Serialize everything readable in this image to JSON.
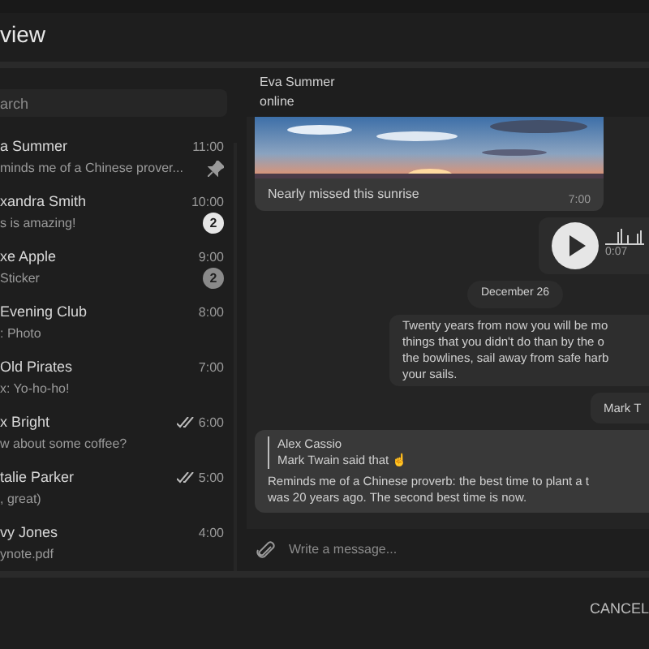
{
  "dialog": {
    "title": "view"
  },
  "search": {
    "placeholder": "arch"
  },
  "chats": [
    {
      "name": "a Summer",
      "time": "11:00",
      "preview": "minds me of a Chinese prover...",
      "kind": "pinned"
    },
    {
      "name": "xandra Smith",
      "time": "10:00",
      "preview": "s is amazing!",
      "kind": "badge",
      "count": "2",
      "muted": false
    },
    {
      "name": "xe Apple",
      "time": "9:00",
      "preview": "Sticker",
      "kind": "badge",
      "count": "2",
      "muted": true
    },
    {
      "name": "Evening Club",
      "time": "8:00",
      "preview": ": Photo",
      "kind": "plain"
    },
    {
      "name": "Old Pirates",
      "time": "7:00",
      "preview": "x: Yo-ho-ho!",
      "kind": "plain"
    },
    {
      "name": "x Bright",
      "time": "6:00",
      "preview": "w about some coffee?",
      "kind": "read"
    },
    {
      "name": "talie Parker",
      "time": "5:00",
      "preview": ", great)",
      "kind": "read"
    },
    {
      "name": "vy Jones",
      "time": "4:00",
      "preview": "ynote.pdf",
      "kind": "plain"
    }
  ],
  "chat": {
    "name": "Eva Summer",
    "status": "online",
    "messages": [
      {
        "caption": "Nearly missed this sunrise",
        "time": "7:00"
      },
      {
        "kind": "voice",
        "duration": "0:07"
      },
      {
        "kind": "date",
        "text": "December 26"
      },
      {
        "kind": "text",
        "lines": [
          "Twenty years from now you will be mo",
          "things that you didn't do than by the o",
          "the bowlines, sail away from safe harb",
          "your sails."
        ]
      },
      {
        "kind": "short",
        "text": "Mark T"
      },
      {
        "kind": "reply",
        "quote_author": "Alex Cassio",
        "quote_text": "Mark Twain said that ☝",
        "lines": [
          "Reminds me of a Chinese proverb: the best time to plant a t",
          "was 20 years ago. The second best time is now."
        ]
      }
    ],
    "composer": {
      "placeholder": "Write a message..."
    }
  },
  "buttons": [
    "CANCEL"
  ]
}
